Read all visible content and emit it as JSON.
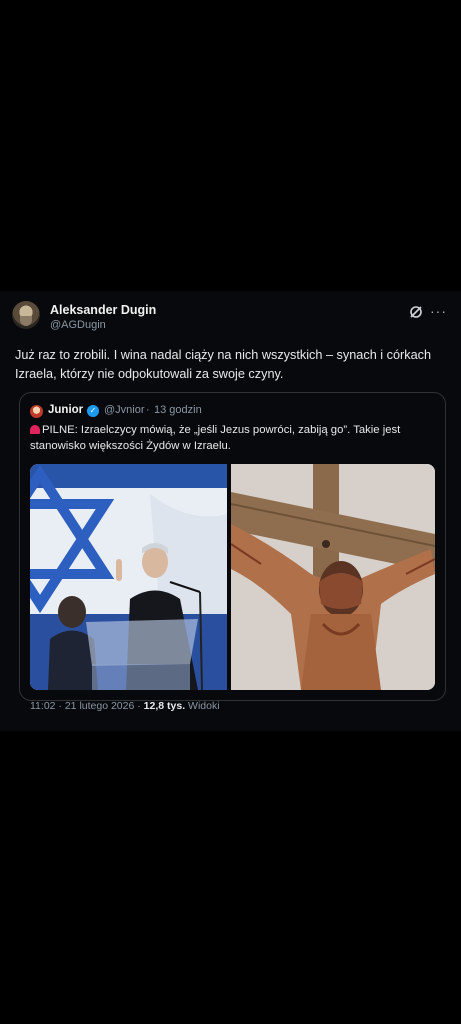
{
  "author": {
    "name": "Aleksander Dugin",
    "handle": "@AGDugin"
  },
  "post": {
    "text": "Już raz to zrobili. I wina nadal ciąży na nich wszystkich – synach i córkach Izraela, którzy nie odpokutowali za swoje czyny."
  },
  "quoted": {
    "name": "Junior",
    "handle": "@Jvnior",
    "separator": "·",
    "time": "13 godzin",
    "text": "PILNE: Izraelczycy mówią, że „jeśli Jezus powróci, zabiją go”. Takie jest stanowisko większości Żydów w Izraelu.",
    "icons": [
      "siren-icon",
      "verified-icon"
    ]
  },
  "meta": {
    "time": "11:02",
    "separator1": "·",
    "date": "21 lutego 2026",
    "separator2": "·",
    "views_count": "12,8 tys.",
    "views_label": "Widoki"
  },
  "colors": {
    "background": "#07090c",
    "text": "#e7e9ea",
    "muted": "#8b98a5",
    "border": "#2f3336",
    "verified": "#1d9bf0"
  }
}
